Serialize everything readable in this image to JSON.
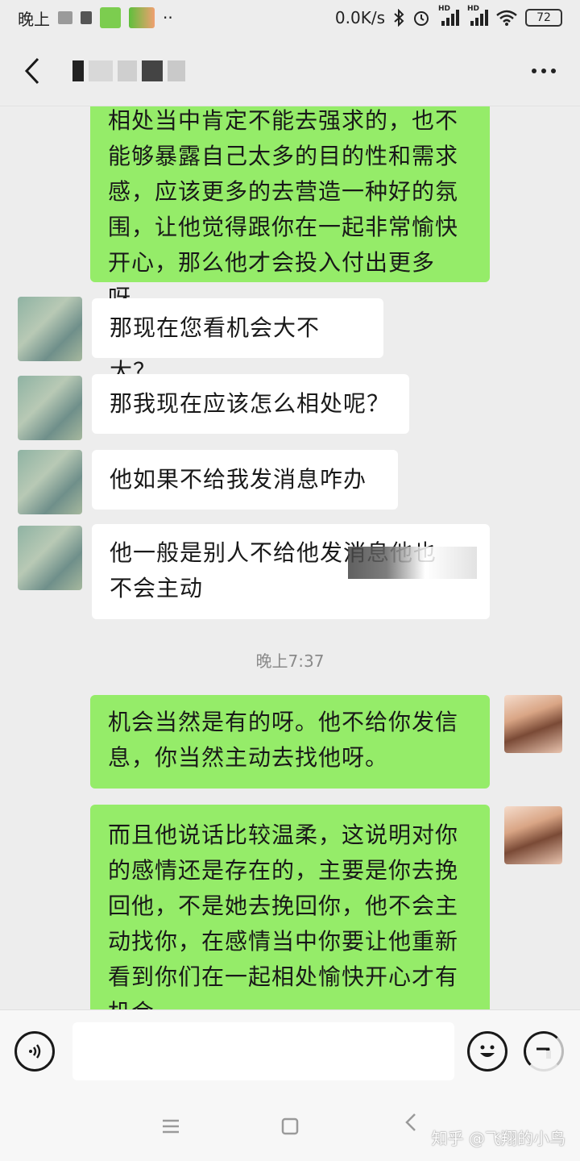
{
  "status_bar": {
    "time_label": "晚上",
    "dots": "··",
    "network_speed": "0.0K/s",
    "hd_label_1": "HD",
    "hd_label_2": "HD",
    "battery": "72"
  },
  "chat": {
    "timestamp": "晚上7:37",
    "messages": [
      {
        "side": "right",
        "text": "相处当中肯定不能去强求的，也不能够暴露自己太多的目的性和需求感，应该更多的去营造一种好的氛围，让他觉得跟你在一起非常愉快开心，那么他才会投入付出更多呀。"
      },
      {
        "side": "left",
        "text": "那现在您看机会大不大？"
      },
      {
        "side": "left",
        "text": "那我现在应该怎么相处呢？"
      },
      {
        "side": "left",
        "text": "他如果不给我发消息咋办"
      },
      {
        "side": "left",
        "text": "他一般是别人不给他发消息他也不会主动"
      },
      {
        "side": "right",
        "text": "机会当然是有的呀。他不给你发信息，你当然主动去找他呀。"
      },
      {
        "side": "right",
        "text": "而且他说话比较温柔，这说明对你的感情还是存在的，主要是你去挽回他，不是她去挽回你，他不会主动找你，在感情当中你要让他重新看到你们在一起相处愉快开心才有机会"
      }
    ],
    "msg1_lines": [
      "相处当中肯定不能去强求的，也不",
      "能够暴露自己太多的目的性和需求",
      "感，应该更多的去营造一种好的氛",
      "围，让他觉得跟你在一起非常愉快",
      "开心，那么他才会投入付出更多呀。"
    ],
    "msg5_lines": [
      "他一般是别人不给他发消息他也",
      "不会主动"
    ],
    "msg6_lines": [
      "机会当然是有的呀。他不给你发信",
      "息，你当然主动去找他呀。"
    ],
    "msg7_lines": [
      "而且他说话比较温柔，这说明对你",
      "的感情还是存在的，主要是你去挽",
      "回他，不是她去挽回你，他不会主",
      "动找你，在感情当中你要让他重新",
      "看到你们在一起相处愉快开心才有",
      "机会"
    ]
  },
  "watermark": "知乎 @飞翔的小鸟"
}
